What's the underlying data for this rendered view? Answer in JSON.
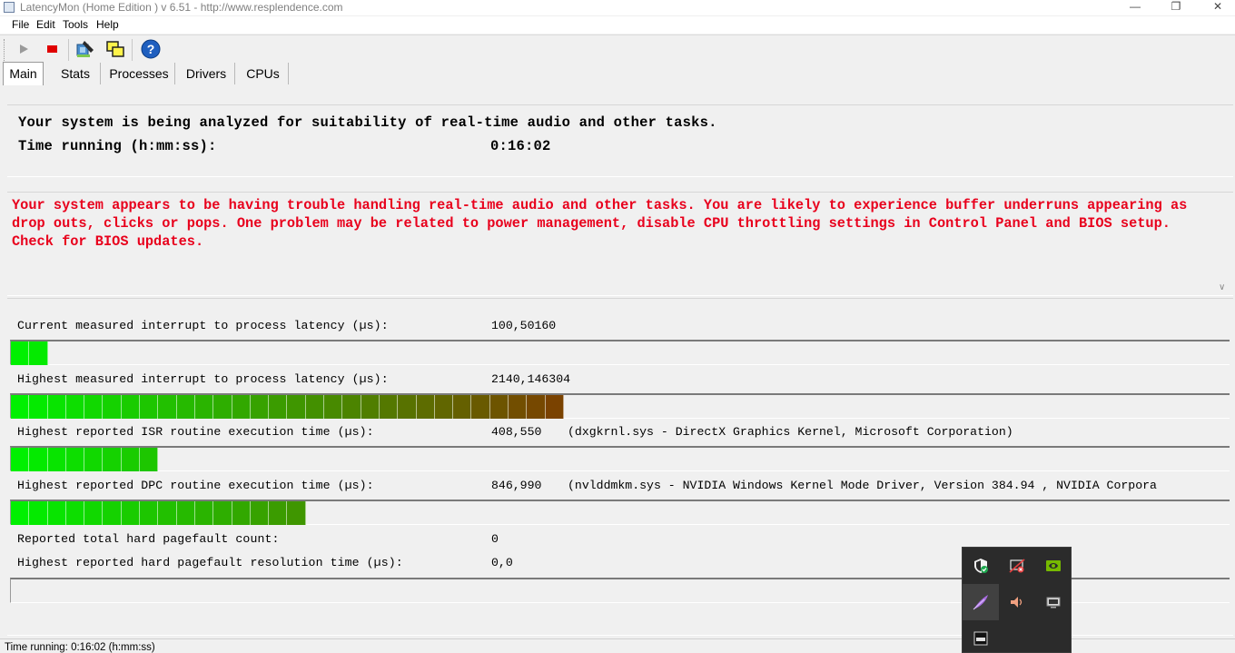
{
  "window": {
    "title": "LatencyMon  (Home Edition )  v 6.51 - http://www.resplendence.com"
  },
  "menu": [
    "File",
    "Edit",
    "Tools",
    "Help"
  ],
  "tabs": [
    "Main",
    "Stats",
    "Processes",
    "Drivers",
    "CPUs"
  ],
  "analysis": {
    "line1": "Your system is being analyzed for suitability of real-time audio and other tasks.",
    "time_label": "Time running (h:mm:ss):",
    "time_value": "0:16:02"
  },
  "warning": "Your system appears to be having trouble handling real-time audio and other tasks. You are likely to experience buffer underruns appearing as drop outs, clicks or pops. One problem may be related to power management, disable CPU throttling settings in Control Panel and BIOS setup. Check for BIOS updates.",
  "metrics": [
    {
      "label": "Current measured interrupt to process latency (µs):",
      "value": "100,50160",
      "extra": "",
      "segments": 2
    },
    {
      "label": "Highest measured interrupt to process latency (µs):",
      "value": "2140,146304",
      "extra": "",
      "segments": 30
    },
    {
      "label": "Highest reported ISR routine execution time (µs):",
      "value": "408,550",
      "extra": "(dxgkrnl.sys - DirectX Graphics Kernel, Microsoft Corporation)",
      "segments": 8
    },
    {
      "label": "Highest reported DPC routine execution time (µs):",
      "value": "846,990",
      "extra": "(nvlddmkm.sys - NVIDIA Windows Kernel Mode Driver, Version 384.94 , NVIDIA Corpora",
      "segments": 16
    },
    {
      "label": "Reported total hard pagefault count:",
      "value": "0",
      "extra": ""
    },
    {
      "label": "Highest reported hard pagefault resolution time (µs):",
      "value": "0,0",
      "extra": "",
      "segments": 0
    }
  ],
  "status": "Time running: 0:16:02  (h:mm:ss)",
  "colors": {
    "warning": "#e8001c",
    "bar_start": "#00f000",
    "bar_end": "#7a4200"
  },
  "tray_icons": [
    "shield-check-icon",
    "network-blocked-icon",
    "nvidia-icon",
    "feather-icon",
    "speaker-icon",
    "monitor-icon",
    "ssd-icon"
  ]
}
